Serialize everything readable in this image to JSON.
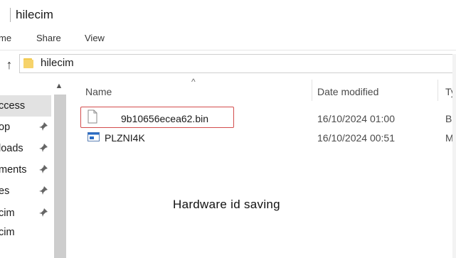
{
  "window": {
    "title": "hilecim"
  },
  "ribbon": {
    "tabs": [
      "me",
      "Share",
      "View"
    ]
  },
  "address": {
    "path": "hilecim"
  },
  "nav_pane": {
    "items": [
      {
        "label": "ccess",
        "pinned": false,
        "selected": true
      },
      {
        "label": "op",
        "pinned": true,
        "selected": false
      },
      {
        "label": "loads",
        "pinned": true,
        "selected": false
      },
      {
        "label": "ments",
        "pinned": true,
        "selected": false
      },
      {
        "label": "es",
        "pinned": true,
        "selected": false
      },
      {
        "label": "cim",
        "pinned": true,
        "selected": false
      },
      {
        "label": "cim",
        "pinned": false,
        "selected": false
      }
    ]
  },
  "columns": {
    "name": "Name",
    "date_modified": "Date modified",
    "type": "Ty"
  },
  "files": [
    {
      "name": "9b10656ecea62.bin",
      "date_modified": "16/10/2024 01:00",
      "type": "BII",
      "icon": "blank-file-icon",
      "highlighted": true
    },
    {
      "name": "PLZNI4K",
      "date_modified": "16/10/2024 00:51",
      "type": "MS",
      "icon": "msi-installer-icon",
      "highlighted": false
    }
  ],
  "caption": "Hardware id saving",
  "colors": {
    "highlight_border": "#d34c4c",
    "folder_yellow": "#f2c94c",
    "selection_gray": "#e2e2e2"
  }
}
